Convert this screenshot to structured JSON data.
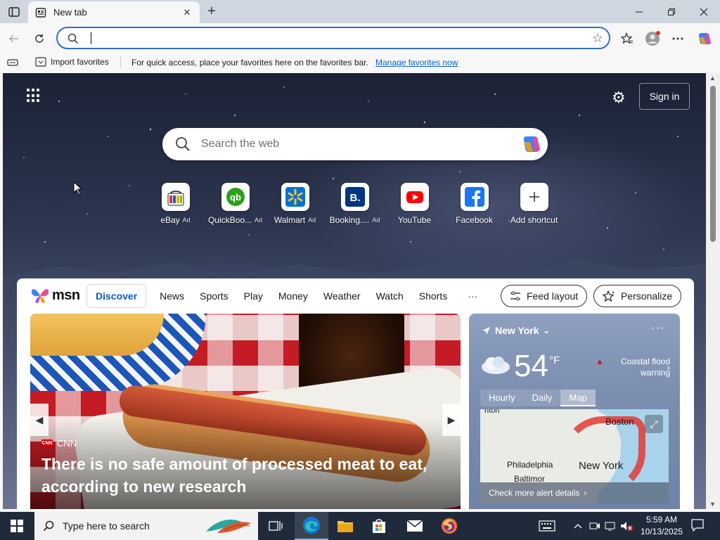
{
  "browser": {
    "tab_title": "New tab",
    "new_tab_symbol": "+",
    "address_placeholder": "",
    "window_controls": [
      "minimize",
      "restore",
      "close"
    ]
  },
  "favorites_bar": {
    "import_label": "Import favorites",
    "hint": "For quick access, place your favorites here on the favorites bar.",
    "manage_link": "Manage favorites now"
  },
  "ntp": {
    "signin": "Sign in",
    "search_placeholder": "Search the web",
    "shortcuts": [
      {
        "label": "eBay",
        "ad": "Ad",
        "icon": "ebay-icon"
      },
      {
        "label": "QuickBoo...",
        "ad": "Ad",
        "icon": "quickbooks-icon"
      },
      {
        "label": "Walmart",
        "ad": "Ad",
        "icon": "walmart-icon"
      },
      {
        "label": "Booking....",
        "ad": "Ad",
        "icon": "booking-icon"
      },
      {
        "label": "YouTube",
        "ad": "",
        "icon": "youtube-icon"
      },
      {
        "label": "Facebook",
        "ad": "",
        "icon": "facebook-icon"
      },
      {
        "label": "Add shortcut",
        "ad": "",
        "icon": "plus-icon"
      }
    ]
  },
  "msn": {
    "logo": "msn",
    "nav": [
      "Discover",
      "News",
      "Sports",
      "Play",
      "Money",
      "Weather",
      "Watch",
      "Shorts"
    ],
    "more": "···",
    "feed_layout": "Feed layout",
    "personalize": "Personalize",
    "hero": {
      "source": "CNN",
      "badge": "CNN",
      "headline": "There is no safe amount of processed meat to eat, according to new research"
    },
    "weather": {
      "location": "New York",
      "temp": "54",
      "unit": "°F",
      "alert": "Coastal flood warning",
      "tabs": [
        "Hourly",
        "Daily",
        "Map"
      ],
      "active_tab": "Map",
      "map_cities": [
        "Boston",
        "Philadelphia",
        "New York",
        "Baltimor"
      ],
      "map_edge": "nton",
      "more_alert": "Check more alert details"
    }
  },
  "taskbar": {
    "search_placeholder": "Type here to search",
    "time": "5:59 AM",
    "date": "10/13/2025"
  },
  "colors": {
    "accent": "#0b5cc7",
    "address_border": "#2f6fc4",
    "taskbar": "#1f2b3a",
    "alert_red": "#c81d1d"
  }
}
